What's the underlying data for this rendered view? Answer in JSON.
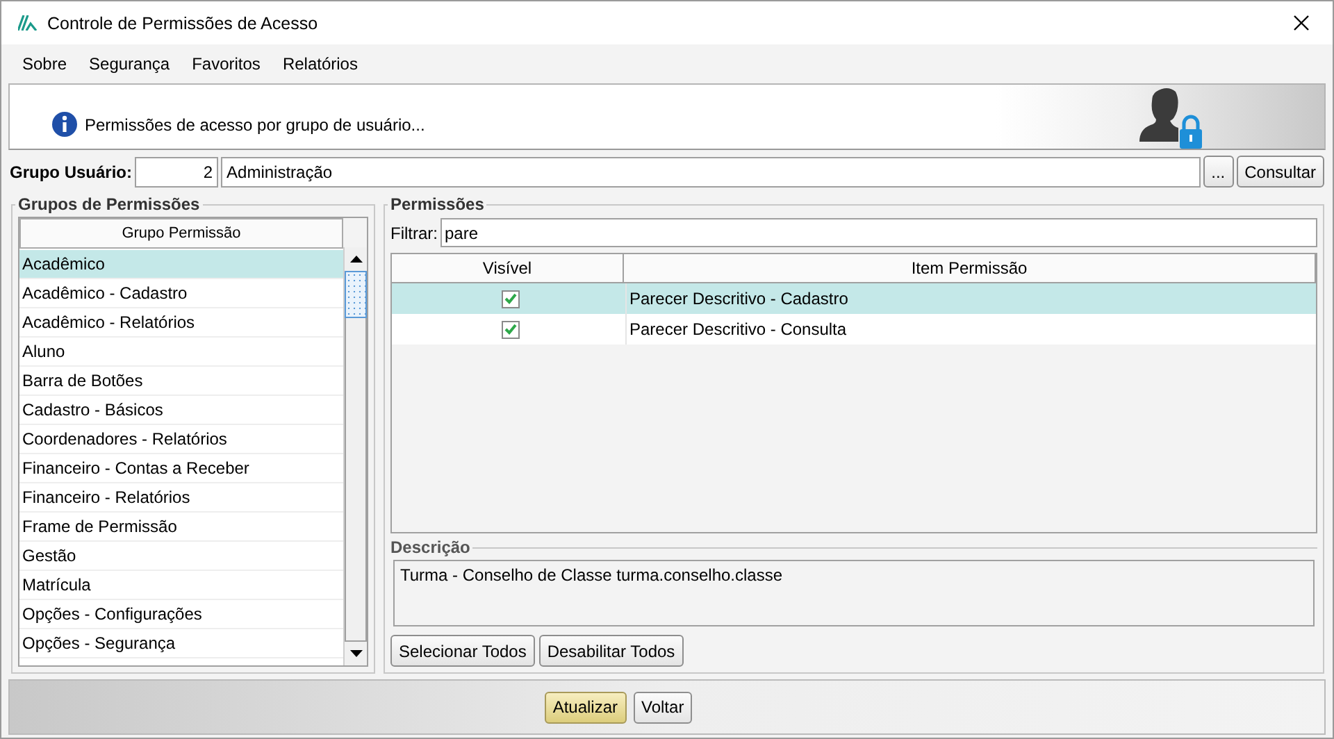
{
  "window": {
    "title": "Controle de Permissões de Acesso"
  },
  "menu": [
    {
      "label": "Sobre"
    },
    {
      "label": "Segurança"
    },
    {
      "label": "Favoritos"
    },
    {
      "label": "Relatórios"
    }
  ],
  "banner": {
    "text": "Permissões de acesso por grupo de usuário..."
  },
  "user_group": {
    "label": "Grupo Usuário:",
    "code": "2",
    "name": "Administração",
    "browse_button": "...",
    "query_button": "Consultar"
  },
  "groups_panel": {
    "title": "Grupos de Permissões",
    "column": "Grupo Permissão",
    "items": [
      {
        "label": "Acadêmico",
        "selected": true
      },
      {
        "label": "Acadêmico - Cadastro",
        "selected": false
      },
      {
        "label": "Acadêmico - Relatórios",
        "selected": false
      },
      {
        "label": "Aluno",
        "selected": false
      },
      {
        "label": "Barra de Botões",
        "selected": false
      },
      {
        "label": "Cadastro - Básicos",
        "selected": false
      },
      {
        "label": "Coordenadores - Relatórios",
        "selected": false
      },
      {
        "label": "Financeiro - Contas a Receber",
        "selected": false
      },
      {
        "label": "Financeiro - Relatórios",
        "selected": false
      },
      {
        "label": "Frame de Permissão",
        "selected": false
      },
      {
        "label": "Gestão",
        "selected": false
      },
      {
        "label": "Matrícula",
        "selected": false
      },
      {
        "label": "Opções - Configurações",
        "selected": false
      },
      {
        "label": "Opções - Segurança",
        "selected": false
      }
    ]
  },
  "permissions_panel": {
    "title": "Permissões",
    "filter_label": "Filtrar:",
    "filter_value": "pare",
    "columns": [
      "Visível",
      "Item Permissão"
    ],
    "rows": [
      {
        "visible": true,
        "item": "Parecer Descritivo - Cadastro",
        "selected": true
      },
      {
        "visible": true,
        "item": "Parecer Descritivo - Consulta",
        "selected": false
      }
    ],
    "description_title": "Descrição",
    "description": "Turma - Conselho de Classe turma.conselho.classe",
    "buttons": [
      "Selecionar Todos",
      "Desabilitar Todos"
    ]
  },
  "footer": {
    "buttons": [
      {
        "label": "Atualizar",
        "kind": "primary"
      },
      {
        "label": "Voltar",
        "kind": "normal"
      }
    ]
  }
}
